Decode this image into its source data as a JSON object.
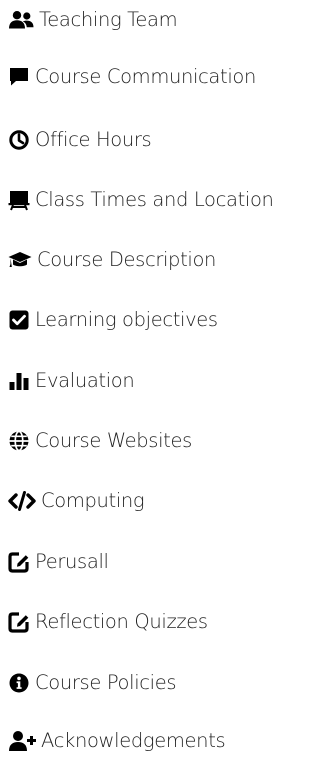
{
  "nav": {
    "items": [
      {
        "label": "Teaching Team",
        "icon": "users-icon"
      },
      {
        "label": "Course Communication",
        "icon": "comment-icon"
      },
      {
        "label": "Office Hours",
        "icon": "clock-icon"
      },
      {
        "label": "Class Times and Location",
        "icon": "chalkboard-teacher-icon"
      },
      {
        "label": "Course Description",
        "icon": "graduation-cap-icon"
      },
      {
        "label": "Learning objectives",
        "icon": "check-square-icon"
      },
      {
        "label": "Evaluation",
        "icon": "bar-chart-icon"
      },
      {
        "label": "Course Websites",
        "icon": "globe-icon"
      },
      {
        "label": "Computing",
        "icon": "code-icon"
      },
      {
        "label": "Perusall",
        "icon": "edit-icon"
      },
      {
        "label": "Reflection Quizzes",
        "icon": "edit-icon"
      },
      {
        "label": "Course Policies",
        "icon": "info-circle-icon"
      },
      {
        "label": "Acknowledgements",
        "icon": "user-plus-icon"
      }
    ]
  },
  "colors": {
    "text": "#222222",
    "icon": "#000000",
    "background": "#ffffff"
  }
}
